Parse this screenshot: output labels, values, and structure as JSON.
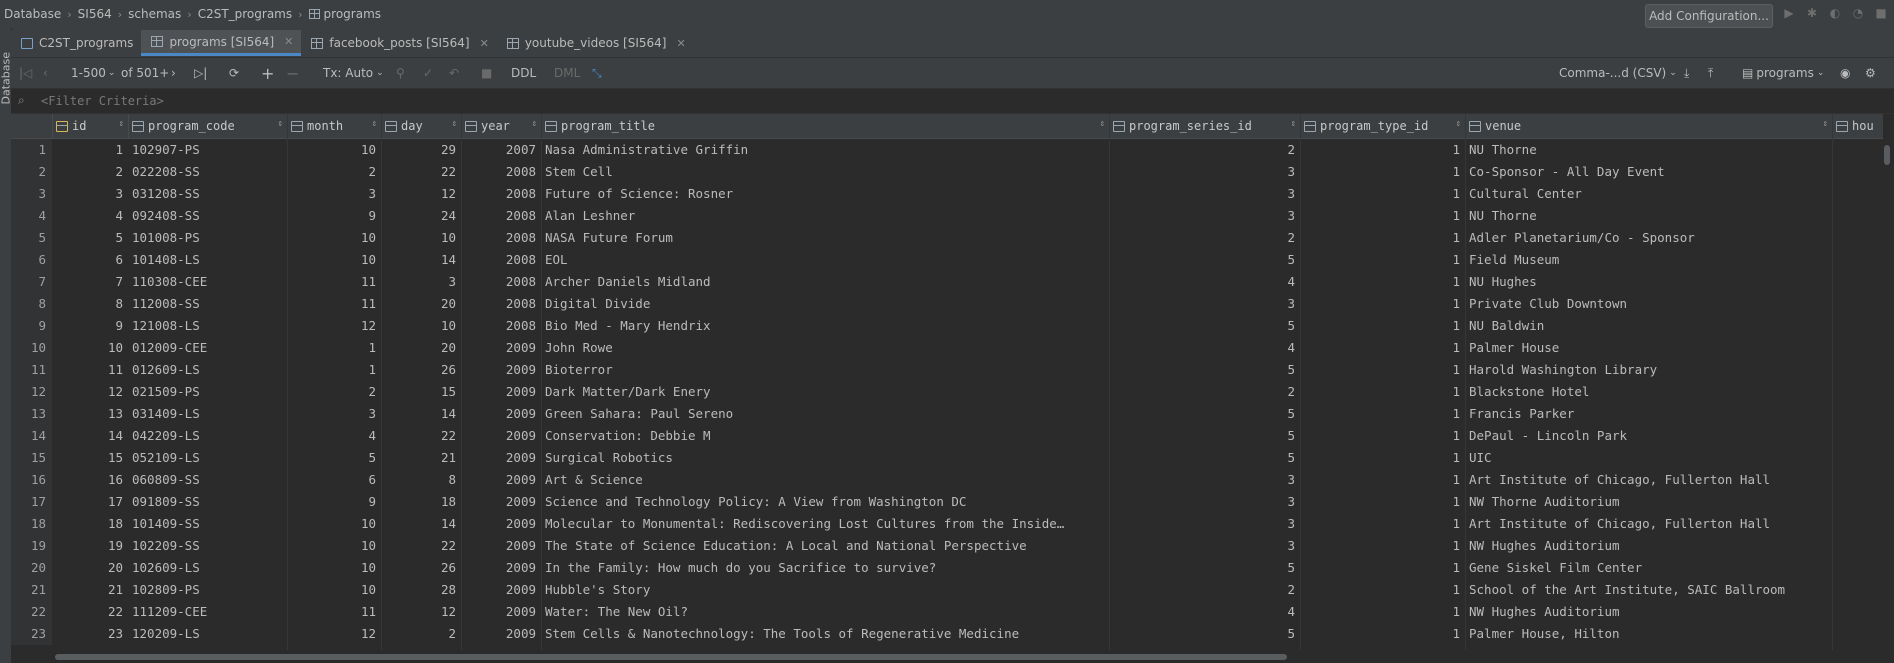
{
  "breadcrumb": [
    "Database",
    "SI564",
    "schemas",
    "C2ST_programs",
    "programs"
  ],
  "add_configuration": "Add Configuration...",
  "sidebar_label": "Database",
  "tabs": [
    {
      "label": "C2ST_programs",
      "icon": "schema-icon",
      "active": false,
      "closable": false
    },
    {
      "label": "programs [SI564]",
      "icon": "table-icon",
      "active": true,
      "closable": true
    },
    {
      "label": "facebook_posts [SI564]",
      "icon": "table-icon",
      "active": false,
      "closable": true
    },
    {
      "label": "youtube_videos [SI564]",
      "icon": "table-icon",
      "active": false,
      "closable": true
    }
  ],
  "toolbar": {
    "page_range": "1-500",
    "page_of": "of 501+",
    "tx_mode": "Tx: Auto",
    "ddl": "DDL",
    "dml": "DML",
    "export_format": "Comma-...d (CSV)",
    "table_selector": "programs"
  },
  "filter": {
    "placeholder": "<Filter Criteria>"
  },
  "columns": [
    "id",
    "program_code",
    "month",
    "day",
    "year",
    "program_title",
    "program_series_id",
    "program_type_id",
    "venue",
    "hou"
  ],
  "rows": [
    {
      "rn": "1",
      "id": "1",
      "code": "102907-PS",
      "month": "10",
      "day": "29",
      "year": "2007",
      "title": "Nasa Administrative Griffin",
      "series": "2",
      "type": "1",
      "venue": "NU Thorne"
    },
    {
      "rn": "2",
      "id": "2",
      "code": "022208-SS",
      "month": "2",
      "day": "22",
      "year": "2008",
      "title": "Stem Cell",
      "series": "3",
      "type": "1",
      "venue": "Co-Sponsor - All Day Event"
    },
    {
      "rn": "3",
      "id": "3",
      "code": "031208-SS",
      "month": "3",
      "day": "12",
      "year": "2008",
      "title": "Future of Science: Rosner",
      "series": "3",
      "type": "1",
      "venue": "Cultural Center"
    },
    {
      "rn": "4",
      "id": "4",
      "code": "092408-SS",
      "month": "9",
      "day": "24",
      "year": "2008",
      "title": "Alan Leshner",
      "series": "3",
      "type": "1",
      "venue": "NU Thorne"
    },
    {
      "rn": "5",
      "id": "5",
      "code": "101008-PS",
      "month": "10",
      "day": "10",
      "year": "2008",
      "title": "NASA Future Forum",
      "series": "2",
      "type": "1",
      "venue": "Adler Planetarium/Co - Sponsor"
    },
    {
      "rn": "6",
      "id": "6",
      "code": "101408-LS",
      "month": "10",
      "day": "14",
      "year": "2008",
      "title": "EOL",
      "series": "5",
      "type": "1",
      "venue": "Field Museum"
    },
    {
      "rn": "7",
      "id": "7",
      "code": "110308-CEE",
      "month": "11",
      "day": "3",
      "year": "2008",
      "title": "Archer Daniels Midland",
      "series": "4",
      "type": "1",
      "venue": "NU Hughes"
    },
    {
      "rn": "8",
      "id": "8",
      "code": "112008-SS",
      "month": "11",
      "day": "20",
      "year": "2008",
      "title": "Digital Divide",
      "series": "3",
      "type": "1",
      "venue": "Private Club Downtown"
    },
    {
      "rn": "9",
      "id": "9",
      "code": "121008-LS",
      "month": "12",
      "day": "10",
      "year": "2008",
      "title": "Bio Med - Mary Hendrix",
      "series": "5",
      "type": "1",
      "venue": "NU Baldwin"
    },
    {
      "rn": "10",
      "id": "10",
      "code": "012009-CEE",
      "month": "1",
      "day": "20",
      "year": "2009",
      "title": "John Rowe",
      "series": "4",
      "type": "1",
      "venue": "Palmer House"
    },
    {
      "rn": "11",
      "id": "11",
      "code": "012609-LS",
      "month": "1",
      "day": "26",
      "year": "2009",
      "title": "Bioterror",
      "series": "5",
      "type": "1",
      "venue": "Harold Washington Library"
    },
    {
      "rn": "12",
      "id": "12",
      "code": "021509-PS",
      "month": "2",
      "day": "15",
      "year": "2009",
      "title": "Dark Matter/Dark Enery",
      "series": "2",
      "type": "1",
      "venue": "Blackstone Hotel"
    },
    {
      "rn": "13",
      "id": "13",
      "code": "031409-LS",
      "month": "3",
      "day": "14",
      "year": "2009",
      "title": "Green Sahara: Paul Sereno",
      "series": "5",
      "type": "1",
      "venue": "Francis Parker"
    },
    {
      "rn": "14",
      "id": "14",
      "code": "042209-LS",
      "month": "4",
      "day": "22",
      "year": "2009",
      "title": "Conservation: Debbie M",
      "series": "5",
      "type": "1",
      "venue": "DePaul - Lincoln Park"
    },
    {
      "rn": "15",
      "id": "15",
      "code": "052109-LS",
      "month": "5",
      "day": "21",
      "year": "2009",
      "title": "Surgical Robotics",
      "series": "5",
      "type": "1",
      "venue": "UIC"
    },
    {
      "rn": "16",
      "id": "16",
      "code": "060809-SS",
      "month": "6",
      "day": "8",
      "year": "2009",
      "title": "Art & Science",
      "series": "3",
      "type": "1",
      "venue": "Art Institute of Chicago, Fullerton Hall"
    },
    {
      "rn": "17",
      "id": "17",
      "code": "091809-SS",
      "month": "9",
      "day": "18",
      "year": "2009",
      "title": "Science and Technology Policy: A View from Washington DC",
      "series": "3",
      "type": "1",
      "venue": "NW Thorne Auditorium"
    },
    {
      "rn": "18",
      "id": "18",
      "code": "101409-SS",
      "month": "10",
      "day": "14",
      "year": "2009",
      "title": "Molecular to Monumental: Rediscovering Lost Cultures from the Inside…",
      "series": "3",
      "type": "1",
      "venue": "Art Institute of Chicago, Fullerton Hall"
    },
    {
      "rn": "19",
      "id": "19",
      "code": "102209-SS",
      "month": "10",
      "day": "22",
      "year": "2009",
      "title": "The State of Science Education: A Local and National Perspective",
      "series": "3",
      "type": "1",
      "venue": "NW Hughes Auditorium"
    },
    {
      "rn": "20",
      "id": "20",
      "code": "102609-LS",
      "month": "10",
      "day": "26",
      "year": "2009",
      "title": "In the Family: How much do you Sacrifice to survive?",
      "series": "5",
      "type": "1",
      "venue": "Gene Siskel Film Center"
    },
    {
      "rn": "21",
      "id": "21",
      "code": "102809-PS",
      "month": "10",
      "day": "28",
      "year": "2009",
      "title": "Hubble's Story",
      "series": "2",
      "type": "1",
      "venue": "School of the Art Institute, SAIC Ballroom"
    },
    {
      "rn": "22",
      "id": "22",
      "code": "111209-CEE",
      "month": "11",
      "day": "12",
      "year": "2009",
      "title": "Water: The New Oil?",
      "series": "4",
      "type": "1",
      "venue": "NW Hughes Auditorium"
    },
    {
      "rn": "23",
      "id": "23",
      "code": "120209-LS",
      "month": "12",
      "day": "2",
      "year": "2009",
      "title": "Stem Cells & Nanotechnology: The Tools of Regenerative Medicine",
      "series": "5",
      "type": "1",
      "venue": "Palmer House, Hilton"
    }
  ]
}
